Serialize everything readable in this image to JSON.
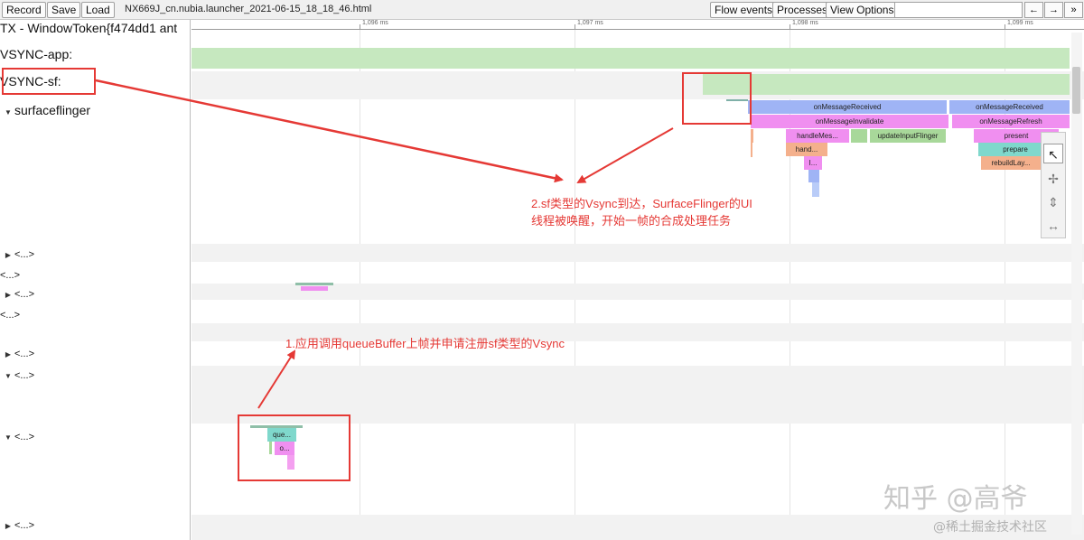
{
  "toolbar": {
    "record": "Record",
    "save": "Save",
    "load": "Load",
    "title": "NX669J_cn.nubia.launcher_2021-06-15_18_18_46.html",
    "flow_events": "Flow events",
    "processes": "Processes",
    "view_options": "View Options",
    "prev": "←",
    "next": "→",
    "more": "»"
  },
  "ruler": {
    "ticks": [
      "1,096 ms",
      "1,097 ms",
      "1,098 ms",
      "1,099 ms"
    ]
  },
  "tracks": {
    "top_cut": "TX - WindowToken{f474dd1 ant",
    "vsync_app": "VSYNC-app:",
    "vsync_sf": "VSYNC-sf:",
    "surfaceflinger": "surfaceflinger",
    "collapsed": [
      "<...>",
      "<...>",
      "<...>",
      "<...>",
      "<...>",
      "<...>",
      "<...>",
      "<...>"
    ]
  },
  "slices": {
    "on_message_received_1": "onMessageReceived",
    "on_message_received_2": "onMessageReceived",
    "on_message_invalidate": "onMessageInvalidate",
    "on_message_refresh": "onMessageRefresh",
    "handle_message": "handleMes...",
    "update_input_flinger": "updateInputFlinger",
    "present": "present",
    "hand": "hand...",
    "prepare": "prepare",
    "rebuild_layers": "rebuildLay...",
    "i_slice": "I...",
    "queue_buffer": "que...",
    "o_slice": "o..."
  },
  "annotations": {
    "note1": "1.应用调用queueBuffer上帧并申请注册sf类型的Vsync",
    "note2_line1": "2.sf类型的Vsync到达，SurfaceFlinger的UI",
    "note2_line2": "线程被唤醒，开始一帧的合成处理任务"
  },
  "watermark": {
    "main": "知乎 @高爷",
    "sub": "@稀土掘金技术社区"
  },
  "colors": {
    "annotation": "#e53935",
    "vsync_bar": "#c6e8bf",
    "blue_slice": "#9fb4f5",
    "pink_slice": "#f08ff0",
    "green_slice": "#a8d89a",
    "orange_slice": "#f4b08c",
    "teal_slice": "#7fd8cc"
  }
}
